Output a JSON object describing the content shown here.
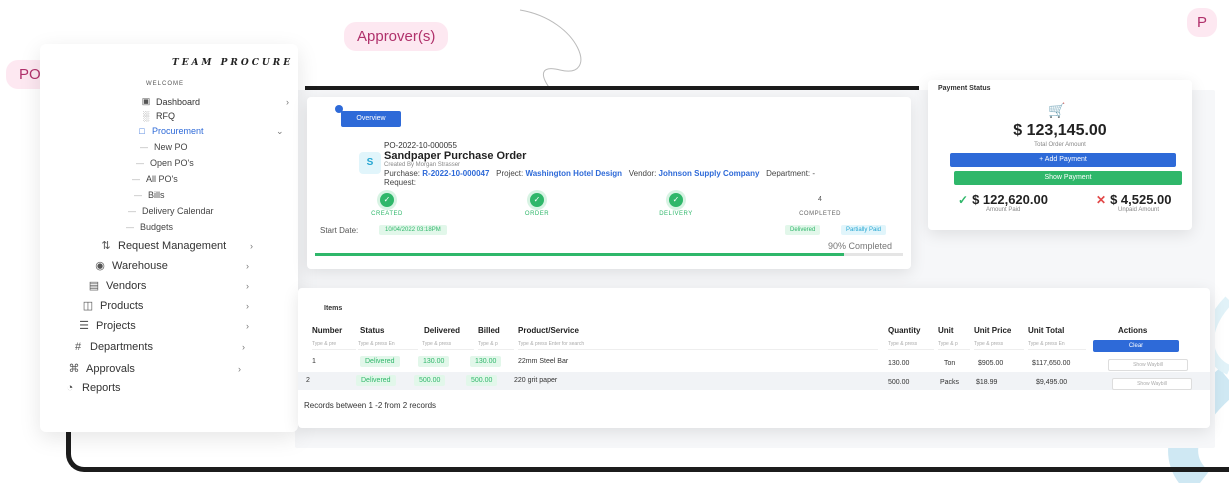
{
  "tags": {
    "po_manager": "PO Manager",
    "approvers": "Approver(s)",
    "partial": "P"
  },
  "brand": "TEAM PROCURE",
  "welcome": "WELCOME",
  "nav": {
    "dashboard": "Dashboard",
    "rfq": "RFQ",
    "procurement": "Procurement",
    "new_po": "New PO",
    "open_pos": "Open PO's",
    "all_pos": "All PO's",
    "bills": "Bills",
    "delivery_calendar": "Delivery Calendar",
    "budgets": "Budgets",
    "request_management": "Request Management",
    "warehouse": "Warehouse",
    "vendors": "Vendors",
    "products": "Products",
    "projects": "Projects",
    "departments": "Departments",
    "approvals": "Approvals",
    "reports": "Reports"
  },
  "overview": {
    "tab": "Overview",
    "avatar": "S",
    "po_number": "PO-2022-10-000055",
    "title": "Sandpaper Purchase Order",
    "created_by": "Created By Morgan Strasser",
    "purchase_label": "Purchase:",
    "purchase_value": "R-2022-10-000047",
    "project_label": "Project:",
    "project_value": "Washington Hotel Design",
    "vendor_label": "Vendor:",
    "vendor_value": "Johnson Supply Company",
    "department_label": "Department: -",
    "request_label": "Request:",
    "steps": [
      {
        "label": "CREATED"
      },
      {
        "label": "ORDER"
      },
      {
        "label": "DELIVERY"
      },
      {
        "number": "4",
        "label": "COMPLETED"
      }
    ],
    "start_label": "Start Date:",
    "start_value": "10/04/2022 03:18PM",
    "status_delivered": "Delivered",
    "status_partially_paid": "Partially Paid",
    "percent_text": "90% Completed",
    "progress": 0.9
  },
  "payment": {
    "header": "Payment Status",
    "total": "$ 123,145.00",
    "total_label": "Total Order Amount",
    "add_button": "+ Add Payment",
    "show_button": "Show Payment",
    "paid": "$ 122,620.00",
    "paid_label": "Amount Paid",
    "unpaid": "$ 4,525.00",
    "unpaid_label": "Unpaid Amount"
  },
  "items": {
    "header": "Items",
    "columns": [
      "Number",
      "Status",
      "Delivered",
      "Billed",
      "Product/Service",
      "Quantity",
      "Unit",
      "Unit Price",
      "Unit Total",
      "Actions"
    ],
    "filters": [
      "Type & pre",
      "Type & press En",
      "Type & press",
      "Type & p",
      "Type & press Enter for search",
      "Type & press",
      "Type & p",
      "Type & press",
      "Type & press En"
    ],
    "clear": "Clear",
    "rows": [
      {
        "number": "1",
        "status": "Delivered",
        "delivered": "130.00",
        "billed": "130.00",
        "product": "22mm Steel Bar",
        "quantity": "130.00",
        "unit": "Ton",
        "unit_price": "$905.00",
        "unit_total": "$117,650.00",
        "action": "Show Waybill"
      },
      {
        "number": "2",
        "status": "Delivered",
        "delivered": "500.00",
        "billed": "500.00",
        "product": "220 grit paper",
        "quantity": "500.00",
        "unit": "Packs",
        "unit_price": "$18.99",
        "unit_total": "$9,495.00",
        "action": "Show Waybill"
      }
    ],
    "records": "Records between 1 -2 from 2 records"
  },
  "colors": {
    "primary": "#2e6ad8",
    "success": "#2fb76a",
    "tag_bg": "#fde8f1",
    "tag_fg": "#b0316b"
  }
}
